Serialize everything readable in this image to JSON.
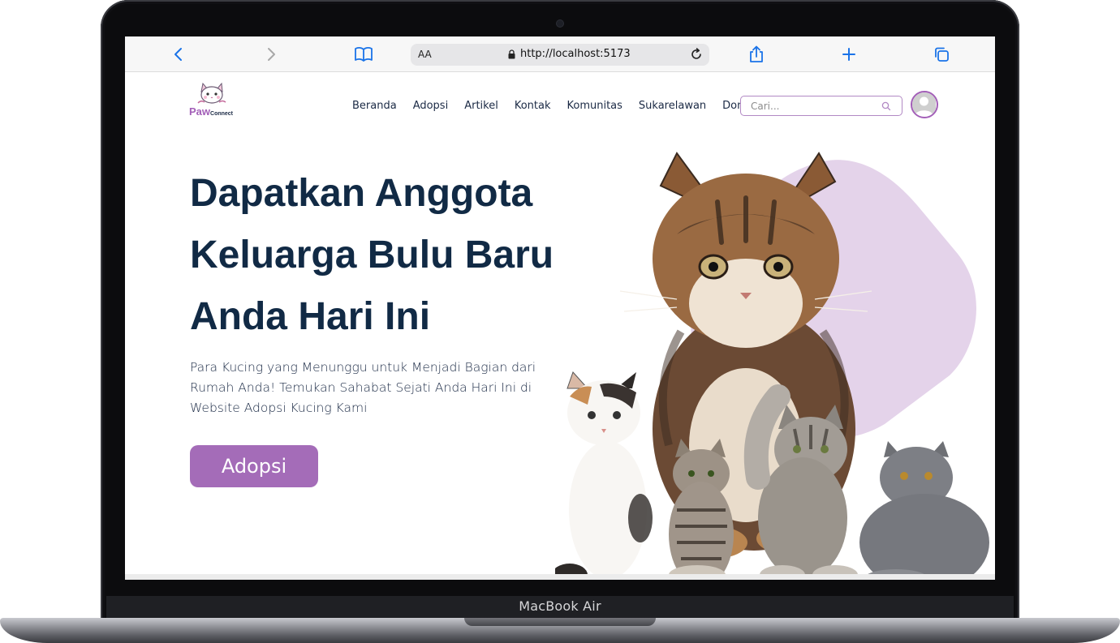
{
  "device": {
    "model_label": "MacBook Air"
  },
  "browser": {
    "url_aa": "AA",
    "url": "http://localhost:5173",
    "icons": [
      "chevron-left-icon",
      "chevron-right-icon",
      "book-icon",
      "lock-icon",
      "reload-icon",
      "share-icon",
      "plus-icon",
      "tabs-icon"
    ]
  },
  "site": {
    "logo": {
      "word1": "Paw",
      "word2": "Connect"
    },
    "nav": [
      "Beranda",
      "Adopsi",
      "Artikel",
      "Kontak",
      "Komunitas",
      "Sukarelawan",
      "Donasi"
    ],
    "search": {
      "placeholder": "Cari..."
    },
    "hero": {
      "title": "Dapatkan Anggota Keluarga Bulu Baru Anda Hari Ini",
      "description": "Para Kucing yang Menunggu untuk Menjadi Bagian dari Rumah Anda! Temukan Sahabat Sejati Anda Hari Ini di Website Adopsi Kucing Kami",
      "button_label": "Adopsi"
    }
  },
  "colors": {
    "accent_purple": "#a46cb8",
    "blob_lilac": "#e4d3ea",
    "heading_navy": "#112a45",
    "browser_blue": "#1a73e8"
  }
}
